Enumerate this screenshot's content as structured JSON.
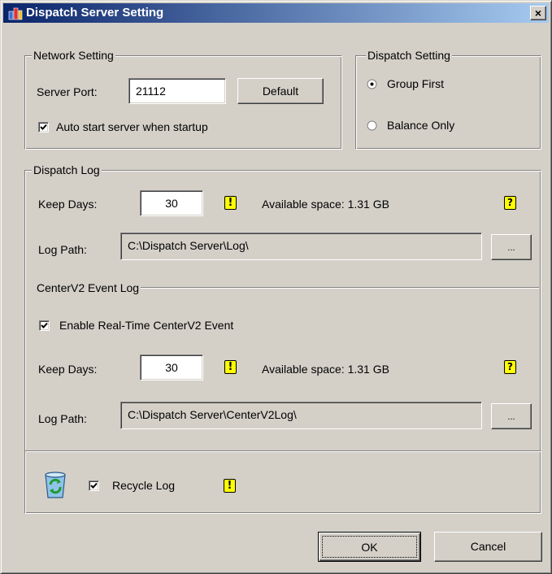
{
  "window": {
    "title": "Dispatch Server Setting",
    "close_glyph": "×"
  },
  "network": {
    "legend": "Network Setting",
    "server_port_label": "Server Port:",
    "server_port_value": "21112",
    "default_button": "Default",
    "auto_start_label": "Auto start server when startup",
    "auto_start_checked": true
  },
  "dispatch": {
    "legend": "Dispatch Setting",
    "options": [
      {
        "label": "Group First",
        "selected": true
      },
      {
        "label": "Balance Only",
        "selected": false
      }
    ]
  },
  "dispatch_log": {
    "legend": "Dispatch Log",
    "keep_days_label": "Keep Days:",
    "keep_days_value": "30",
    "available_space": "Available space: 1.31 GB",
    "log_path_label": "Log Path:",
    "log_path_value": "C:\\Dispatch Server\\Log\\",
    "browse_label": "..."
  },
  "centerv2_log": {
    "legend": "CenterV2 Event Log",
    "enable_label": "Enable Real-Time CenterV2 Event",
    "enable_checked": true,
    "keep_days_label": "Keep Days:",
    "keep_days_value": "30",
    "available_space": "Available space: 1.31 GB",
    "log_path_label": "Log Path:",
    "log_path_value": "C:\\Dispatch Server\\CenterV2Log\\",
    "browse_label": "..."
  },
  "recycle": {
    "label": "Recycle Log",
    "checked": true
  },
  "icons": {
    "warning": "!",
    "help": "?"
  },
  "footer": {
    "ok_label": "OK",
    "cancel_label": "Cancel"
  }
}
